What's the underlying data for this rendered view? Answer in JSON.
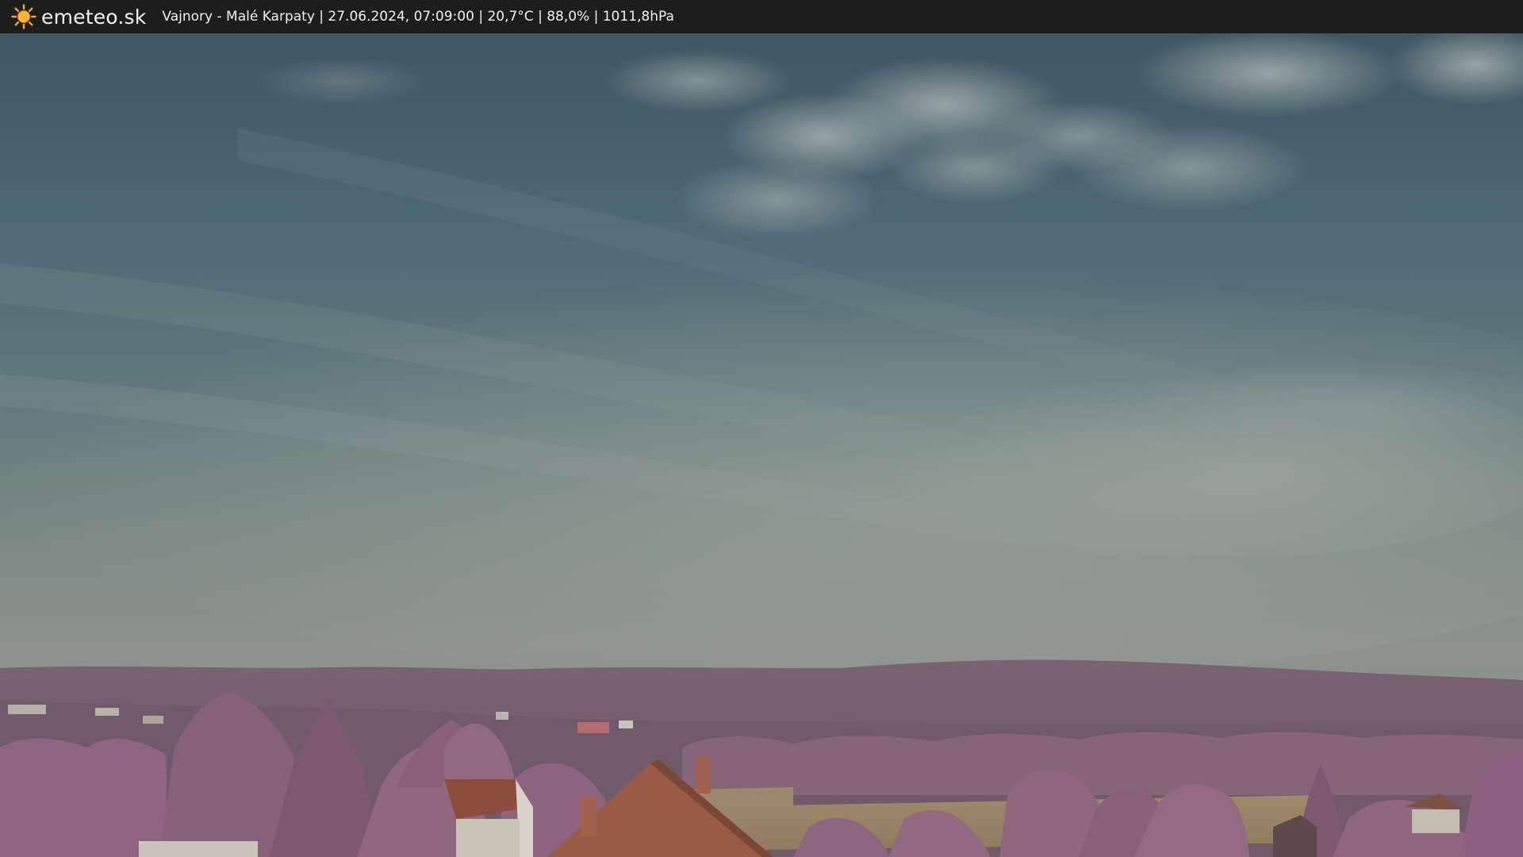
{
  "header": {
    "brand": "emeteo.sk",
    "caption": "Vajnory - Malé Karpaty | 27.06.2024, 07:09:00 | 20,7°C | 88,0% | 1011,8hPa",
    "logo_icon": "sun-icon"
  },
  "colors": {
    "bar_background": "#1d1d1d",
    "sun": "#f5a623",
    "sky_top": "#3f5a64",
    "sky_horizon": "#8f958f",
    "foliage": "#8d5f7e"
  }
}
